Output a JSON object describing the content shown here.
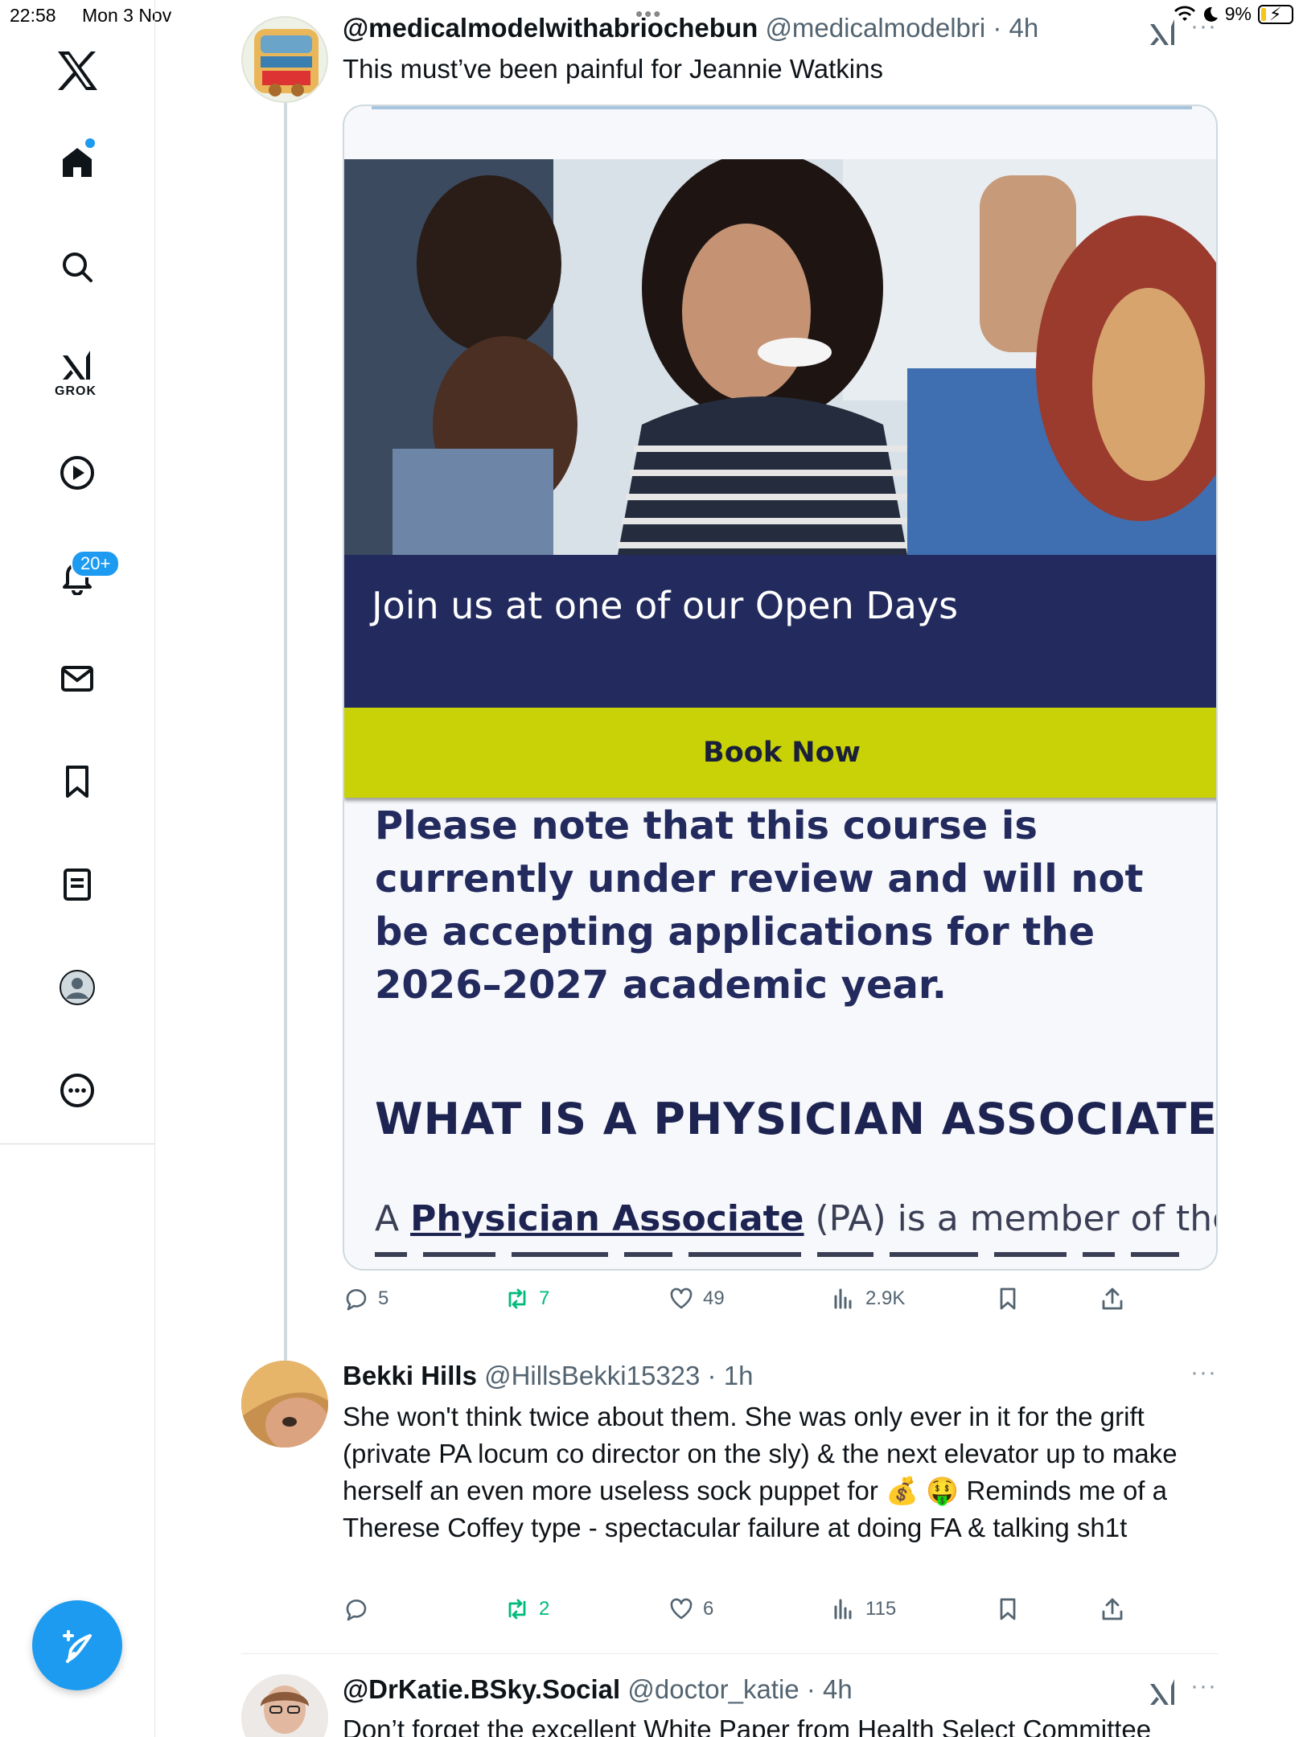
{
  "status_bar": {
    "time": "22:58",
    "date": "Mon 3 Nov",
    "battery": "9%"
  },
  "sidebar": {
    "items": [
      {
        "name": "home-icon",
        "label": "Home"
      },
      {
        "name": "search-icon",
        "label": "Explore"
      },
      {
        "name": "grok-icon",
        "label": "GROK"
      },
      {
        "name": "video-icon",
        "label": "Video"
      },
      {
        "name": "bell-icon",
        "label": "Notifications"
      },
      {
        "name": "mail-icon",
        "label": "Messages"
      },
      {
        "name": "bookmark-icon",
        "label": "Bookmarks"
      },
      {
        "name": "lists-icon",
        "label": "Lists"
      },
      {
        "name": "profile-icon",
        "label": "Profile"
      },
      {
        "name": "more-icon",
        "label": "More"
      }
    ],
    "grok_label": "GROK",
    "notifications_badge": "20+"
  },
  "tweets": [
    {
      "display_name": "@medicalmodelwithabriochebun",
      "handle": "@medicalmodelbri",
      "time": "4h",
      "text": "This must’ve been painful for Jeannie Watkins",
      "card": {
        "banner_text": "Join us at one of our Open Days",
        "button_text": "Book Now",
        "notice": "Please note that this course is currently under review and will not be accepting applications for the 2026–2027 academic year.",
        "heading": "WHAT IS A PHYSICIAN ASSOCIATE?",
        "para_prefix": "A ",
        "para_link": "Physician Associate",
        "para_suffix": " (PA) is a member of the"
      },
      "stats": {
        "replies": "5",
        "reposts": "7",
        "likes": "49",
        "views": "2.9K"
      }
    },
    {
      "display_name": "Bekki Hills",
      "handle": "@HillsBekki15323",
      "time": "1h",
      "text": "She won't think twice about them. She was only ever in it for the grift (private PA locum co director on the sly) & the next elevator up to make herself an even more useless sock puppet for 💰 🤑 Reminds me of a Therese Coffey type - spectacular failure at doing FA & talking sh1t",
      "stats": {
        "replies": "",
        "reposts": "2",
        "likes": "6",
        "views": "115"
      }
    },
    {
      "display_name": "@DrKatie.BSky.Social",
      "handle": "@doctor_katie",
      "time": "4h",
      "text": "Don’t forget the excellent White Paper from Health Select Committee"
    }
  ],
  "colors": {
    "accent": "#1d9bf0",
    "repost_green": "#00ba7c",
    "banner_navy": "#232b5e",
    "button_lime": "#c8d206"
  }
}
